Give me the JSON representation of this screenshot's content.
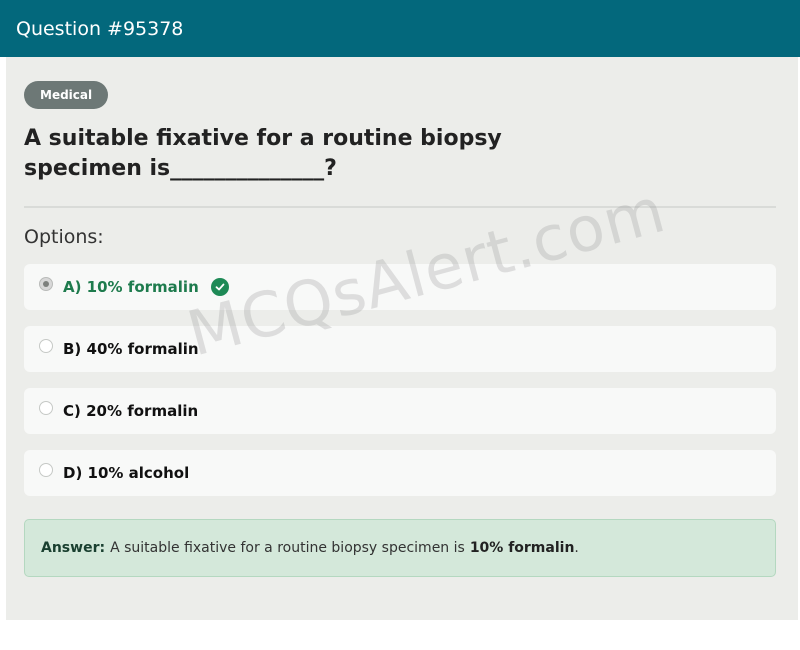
{
  "header": {
    "title": "Question #95378"
  },
  "category_badge": "Medical",
  "question": {
    "text": "A suitable fixative for a routine biopsy specimen is______________?"
  },
  "options_label": "Options:",
  "options": [
    {
      "label": "A) 10% formalin",
      "selected": true,
      "correct": true
    },
    {
      "label": "B) 40% formalin",
      "selected": false,
      "correct": false
    },
    {
      "label": "C) 20% formalin",
      "selected": false,
      "correct": false
    },
    {
      "label": "D) 10% alcohol",
      "selected": false,
      "correct": false
    }
  ],
  "answer": {
    "key_label": "Answer:",
    "text": "A suitable fixative for a routine biopsy specimen is",
    "highlight": "10% formalin",
    "suffix": "."
  },
  "watermark": "MCQsAlert.com",
  "icons": {
    "correct": "check-circle-icon"
  },
  "colors": {
    "header_bg": "#03687c",
    "correct_text": "#1e7b4d",
    "answer_bg": "#d4e8da"
  }
}
